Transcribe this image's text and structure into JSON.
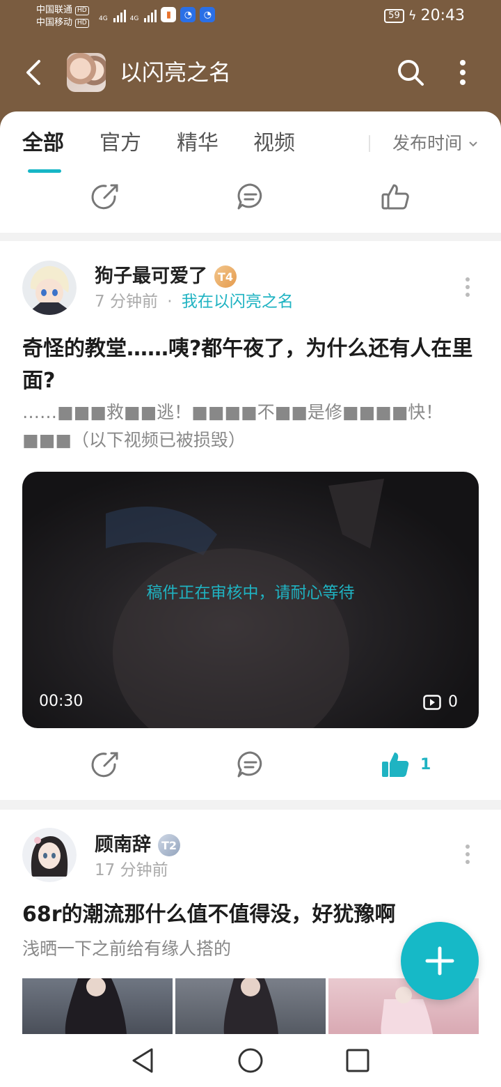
{
  "status_bar": {
    "carrier1": "中国联通",
    "carrier2": "中国移动",
    "hd": "HD",
    "net1": "4G",
    "net2": "4G",
    "battery": "59",
    "time": "20:43"
  },
  "header": {
    "title": "以闪亮之名",
    "back_icon": "back-arrow-icon",
    "search_icon": "search-icon",
    "more_icon": "more-vertical-icon",
    "bg_color": "#7a5c40"
  },
  "tabs": [
    {
      "label": "全部",
      "active": true
    },
    {
      "label": "官方",
      "active": false
    },
    {
      "label": "精华",
      "active": false
    },
    {
      "label": "视频",
      "active": false
    }
  ],
  "sort": {
    "label": "发布时间"
  },
  "accent_color": "#16b6c6",
  "posts": [
    {
      "username": "狗子最可爱了",
      "badge": "T4",
      "time_ago": "7 分钟前",
      "dot": "·",
      "community": "我在以闪亮之名",
      "title": "奇怪的教堂……咦?都午夜了，为什么还有人在里面?",
      "excerpt": "……■■■救■■逃！■■■■不■■是修■■■■快！■■■（以下视频已被损毁）",
      "video": {
        "notice": "稿件正在审核中，请耐心等待",
        "duration": "00:30",
        "views": "0"
      },
      "likes": "1"
    },
    {
      "username": "顾南辞",
      "badge": "T2",
      "time_ago": "17 分钟前",
      "title": "68r的潮流那什么值不值得没，好犹豫啊",
      "excerpt": "浅晒一下之前给有缘人搭的"
    }
  ],
  "fab": {
    "icon": "plus-icon"
  },
  "nav": {
    "back": "nav-back-icon",
    "home": "nav-home-icon",
    "recent": "nav-recent-icon"
  }
}
